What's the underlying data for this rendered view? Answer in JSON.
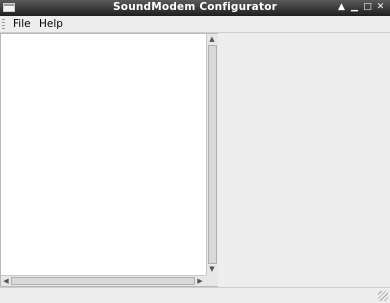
{
  "window": {
    "title": "SoundModem Configurator"
  },
  "titlebar_buttons": [
    {
      "icon": "shade-icon",
      "glyph": "▲"
    },
    {
      "icon": "minimize-icon",
      "glyph": "▁"
    },
    {
      "icon": "maximize-icon",
      "glyph": "□"
    },
    {
      "icon": "close-icon",
      "glyph": "✕"
    }
  ],
  "menubar": {
    "file": "File",
    "help": "Help"
  },
  "statusbar": {
    "text": ""
  },
  "colors": {
    "titlebar_dark": "#1e1e1e",
    "titlebar_light": "#5a5a5a",
    "panel_bg": "#ededed",
    "list_bg": "#ffffff"
  }
}
